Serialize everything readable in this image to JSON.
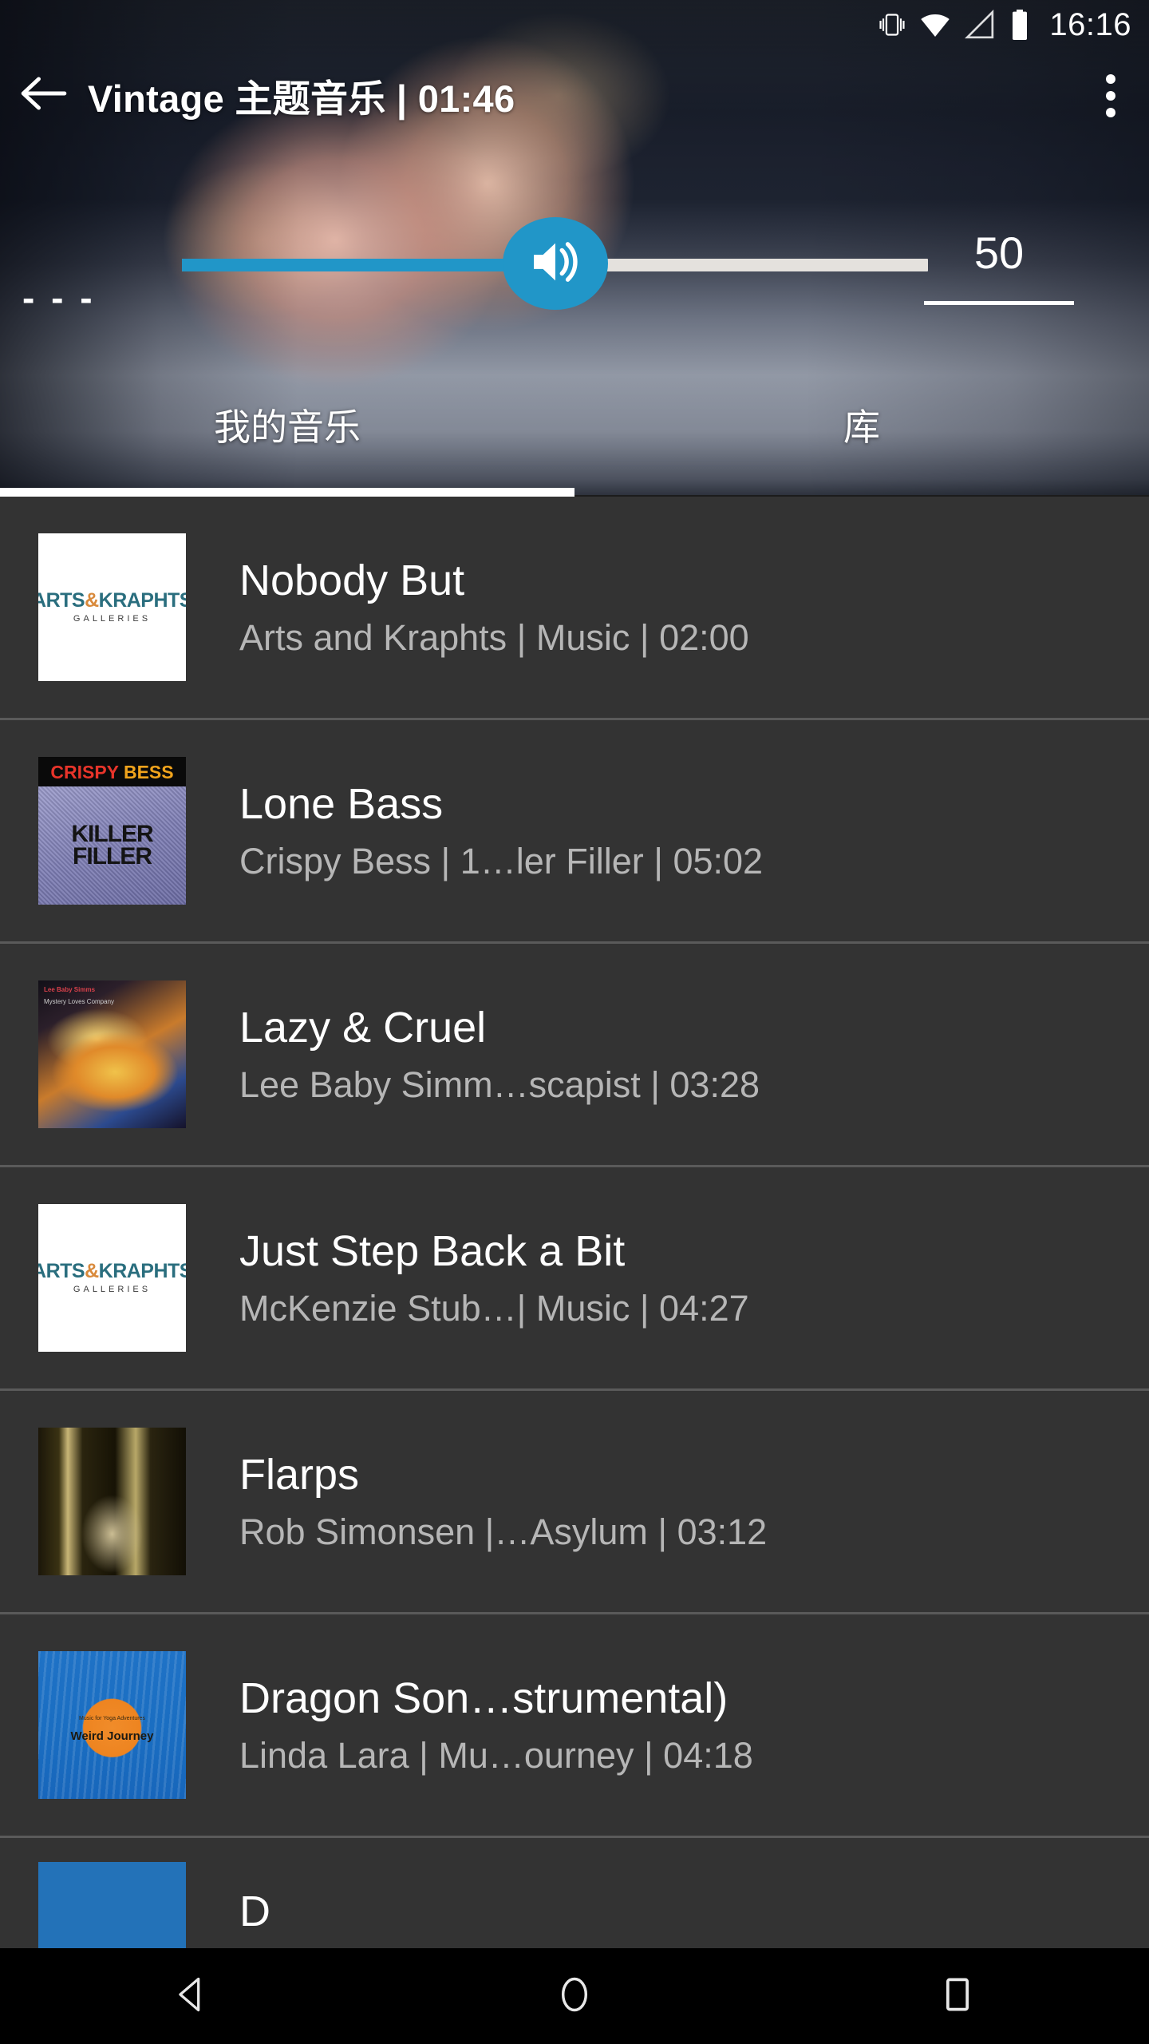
{
  "statusbar": {
    "time": "16:16",
    "icons": [
      "vibrate-icon",
      "wifi-icon",
      "cellular-signal-icon",
      "battery-icon"
    ]
  },
  "actionbar": {
    "back_label": "back-arrow",
    "title": "Vintage 主题音乐 | 01:46",
    "overflow_label": "more-options"
  },
  "volume": {
    "left_placeholder": "- - -",
    "value": "50",
    "percent": 50,
    "accent_color": "#2196C8",
    "track_color": "#E4E1DD",
    "icon": "speaker-volume-icon"
  },
  "tabs": {
    "items": [
      {
        "label": "我的音乐",
        "active": true
      },
      {
        "label": "库",
        "active": false
      }
    ]
  },
  "list": {
    "rows": [
      {
        "title": "Nobody But",
        "subtitle": "Arts and Kraphts | Music | 02:00",
        "art": "arts-and-kraphts-galleries",
        "art_text_main": "ARTS&KRAPHTS",
        "art_text_sub": "GALLERIES"
      },
      {
        "title": "Lone Bass",
        "subtitle": "Crispy Bess | 1…ler Filler | 05:02",
        "art": "crispy-bess-killer-filler",
        "art_text_main": "CRISPY BESS",
        "art_text_sub": "KILLER FILLER"
      },
      {
        "title": "Lazy & Cruel",
        "subtitle": "Lee Baby Simm…scapist | 03:28",
        "art": "lee-baby-simms-mystery",
        "art_text_main": "Lee Baby Simms",
        "art_text_sub": "Mystery Loves Company"
      },
      {
        "title": "Just Step Back a Bit",
        "subtitle": "McKenzie Stub…| Music | 04:27",
        "art": "arts-and-kraphts-galleries",
        "art_text_main": "ARTS&KRAPHTS",
        "art_text_sub": "GALLERIES"
      },
      {
        "title": "Flarps",
        "subtitle": "Rob Simonsen |…Asylum | 03:12",
        "art": "rob-simonsen-asylum",
        "art_text_main": "",
        "art_text_sub": ""
      },
      {
        "title": "Dragon Son…strumental)",
        "subtitle": "Linda Lara | Mu…ourney | 04:18",
        "art": "linda-lara-weird-journey",
        "art_text_main": "Music for Yoga Adventures",
        "art_text_sub": "Weird Journey"
      },
      {
        "title": "D",
        "subtitle": "",
        "art": "blue-album-art",
        "art_text_main": "",
        "art_text_sub": ""
      }
    ]
  },
  "navbar": {
    "back": "android-back-icon",
    "home": "android-home-icon",
    "recents": "android-recents-icon"
  }
}
